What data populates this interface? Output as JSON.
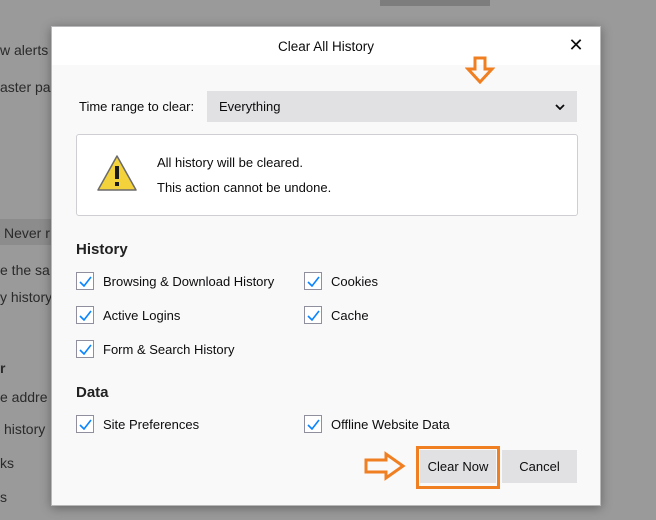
{
  "background": {
    "lines": [
      "w alerts",
      "aster pas",
      "Never r",
      "e the sa",
      "y history",
      "r",
      "e addre",
      "history",
      "ks",
      "s"
    ]
  },
  "dialog": {
    "title": "Clear All History",
    "close_icon": "close-icon",
    "time_range": {
      "label": "Time range to clear:",
      "value": "Everything"
    },
    "warning": {
      "icon": "warning-icon",
      "line1": "All history will be cleared.",
      "line2": "This action cannot be undone."
    },
    "history": {
      "title": "History",
      "items": [
        {
          "label": "Browsing & Download History",
          "checked": true
        },
        {
          "label": "Cookies",
          "checked": true
        },
        {
          "label": "Active Logins",
          "checked": true
        },
        {
          "label": "Cache",
          "checked": true
        },
        {
          "label": "Form & Search History",
          "checked": true
        }
      ]
    },
    "data": {
      "title": "Data",
      "items": [
        {
          "label": "Site Preferences",
          "checked": true
        },
        {
          "label": "Offline Website Data",
          "checked": true
        }
      ]
    },
    "buttons": {
      "clear_now": "Clear Now",
      "cancel": "Cancel"
    }
  },
  "annotations": {
    "arrow_color": "#f07f22"
  }
}
